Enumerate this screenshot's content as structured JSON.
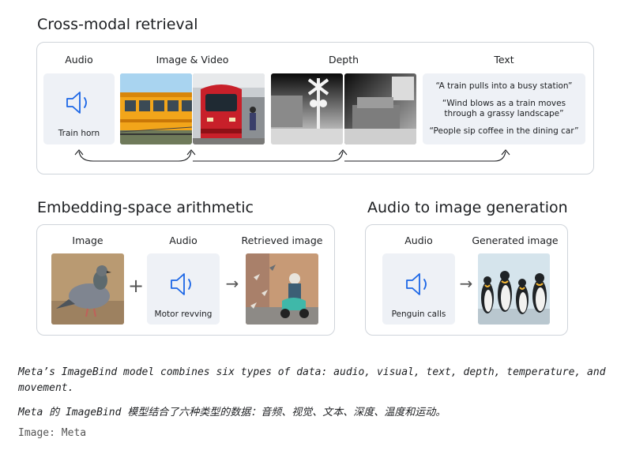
{
  "retrieval": {
    "title": "Cross-modal retrieval",
    "labels": {
      "audio": "Audio",
      "image_video": "Image & Video",
      "depth": "Depth",
      "text": "Text"
    },
    "audio_caption": "Train horn",
    "quotes": [
      "“A train pulls into a busy station”",
      "“Wind blows as a train moves through a grassy landscape”",
      "“People sip coffee in the dining car”"
    ]
  },
  "arithmetic": {
    "title": "Embedding-space arithmetic",
    "labels": {
      "image": "Image",
      "audio": "Audio",
      "retrieved": "Retrieved image"
    },
    "plus": "+",
    "arrow": "→",
    "audio_caption": "Motor revving"
  },
  "generation": {
    "title": "Audio to image generation",
    "labels": {
      "audio": "Audio",
      "generated": "Generated image"
    },
    "arrow": "→",
    "audio_caption": "Penguin calls"
  },
  "caption": {
    "english": "Meta’s ImageBind model combines six types of data: audio, visual, text, depth, temperature, and movement.",
    "chinese": "Meta 的 ImageBind 模型结合了六种类型的数据：音频、视觉、文本、深度、温度和运动。",
    "credit": "Image: Meta"
  },
  "colors": {
    "accent": "#1b66e6",
    "card_bg": "#eef1f6",
    "border": "#cfd4da"
  },
  "icons": {
    "audio": "speaker-icon"
  }
}
